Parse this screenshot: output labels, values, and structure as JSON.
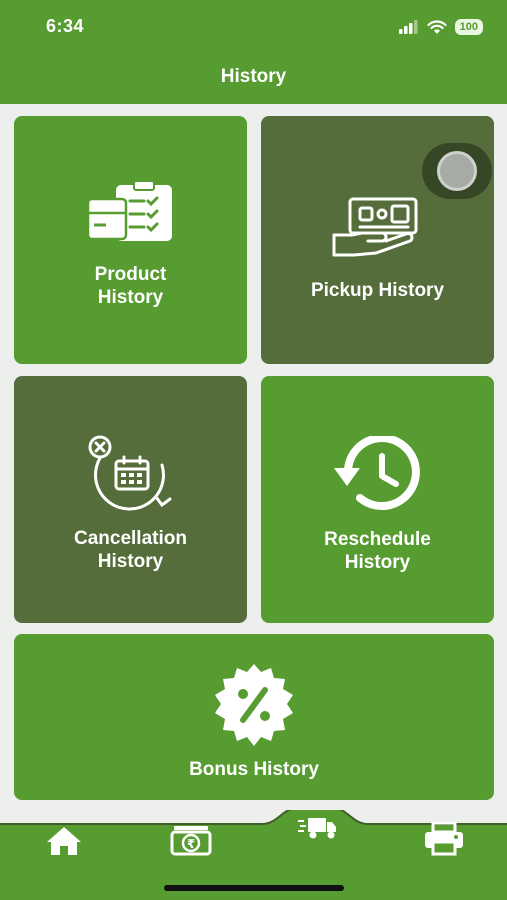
{
  "status_bar": {
    "time": "6:34",
    "battery": "100"
  },
  "header": {
    "title": "History"
  },
  "tiles": [
    {
      "label": "Product\nHistory",
      "icon": "clipboard-box-icon",
      "color": "#579c30"
    },
    {
      "label": "Pickup History",
      "icon": "package-hand-icon",
      "color": "#556d3a"
    },
    {
      "label": "Cancellation\nHistory",
      "icon": "calendar-cancel-icon",
      "color": "#556d3a"
    },
    {
      "label": "Reschedule\nHistory",
      "icon": "clock-history-icon",
      "color": "#579c30"
    },
    {
      "label": "Bonus History",
      "icon": "discount-badge-icon",
      "color": "#579c30"
    }
  ],
  "tabbar": {
    "items": [
      {
        "icon": "home-icon"
      },
      {
        "icon": "rupee-cash-icon"
      },
      {
        "icon": "delivery-truck-icon"
      },
      {
        "icon": "printer-icon"
      }
    ],
    "background": "#579c30"
  }
}
